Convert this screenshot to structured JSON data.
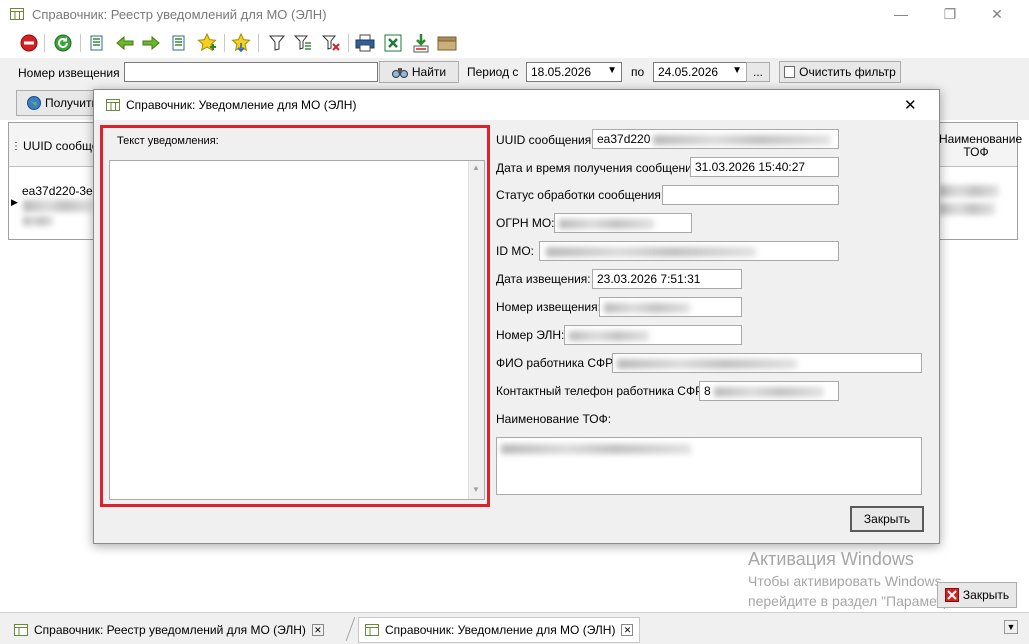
{
  "window": {
    "title": "Справочник: Реестр уведомлений для МО (ЭЛН)",
    "minimize": "—",
    "maximize": "❐",
    "close": "✕"
  },
  "toolbar": {
    "icons": [
      "stop-icon",
      "refresh-icon",
      "record-list-icon",
      "arrow-left-icon",
      "arrow-right-icon",
      "record-list-icon",
      "star-add-icon",
      "star-down-icon",
      "filter-icon",
      "filter-edit-icon",
      "filter-clear-icon",
      "print-icon",
      "excel-icon",
      "export-icon",
      "archive-icon"
    ]
  },
  "filter": {
    "number_label": "Номер извещения",
    "number_value": "",
    "find_button": "Найти",
    "period_label": "Период с",
    "date_from": "18.05.2026",
    "to_label": "по",
    "date_to": "24.05.2026",
    "ellipsis": "...",
    "clear_filter": "Очистить фильтр"
  },
  "subbar": {
    "get_button": "Получить"
  },
  "grid": {
    "col_uuid": "UUID сообщен",
    "col_tof": "Наименование ТОФ",
    "row_uuid": "ea37d220-3e1"
  },
  "dialog": {
    "title": "Справочник: Уведомление для МО (ЭЛН)",
    "close": "✕",
    "text_label": "Текст уведомления:",
    "text_value": "",
    "fields": {
      "uuid_label": "UUID сообщения:",
      "uuid_value": "ea37d220",
      "received_label": "Дата и время получения сообщения:",
      "received_value": "31.03.2026 15:40:27",
      "status_label": "Статус обработки сообщения:",
      "status_value": "",
      "ogrn_label": "ОГРН МО:",
      "id_label": "ID МО:",
      "notice_date_label": "Дата извещения:",
      "notice_date_value": "23.03.2026 7:51:31",
      "notice_number_label": "Номер извещения:",
      "eln_number_label": "Номер ЭЛН:",
      "fio_label": "ФИО работника СФР:",
      "phone_label": "Контактный телефон работника СФР:",
      "phone_value": "8",
      "tof_label": "Наименование ТОФ:"
    },
    "close_button": "Закрыть"
  },
  "main_close_button": "Закрыть",
  "watermark": {
    "line1": "Активация Windows",
    "line2": "Чтобы активировать Windows,",
    "line3": "перейдите в раздел \"Параметры\"."
  },
  "taskbar": {
    "tab1": "Справочник: Реестр уведомлений для МО (ЭЛН)",
    "tab2": "Справочник: Уведомление для МО (ЭЛН)"
  },
  "colors": {
    "highlight": "#e0202a",
    "window_bg": "#f0f0f0"
  }
}
